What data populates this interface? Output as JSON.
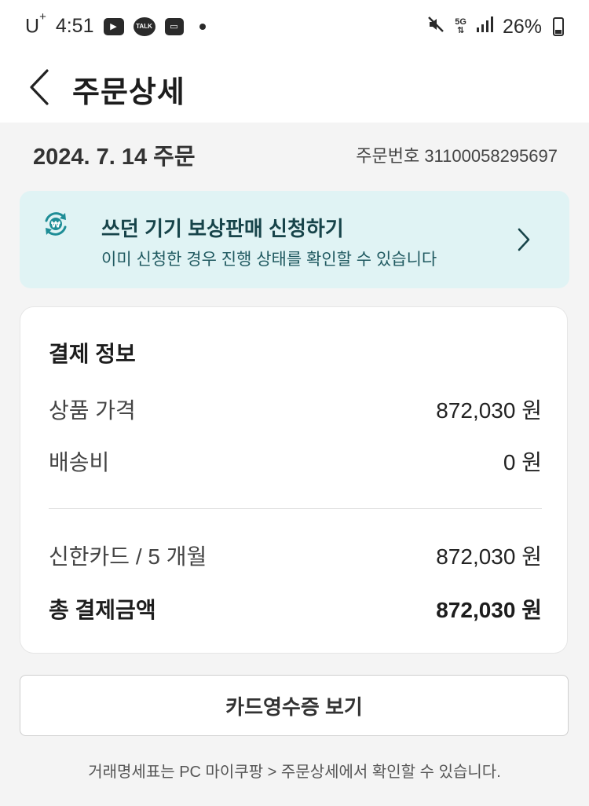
{
  "status_bar": {
    "carrier": "U",
    "carrier_sup": "+",
    "time": "4:51",
    "network": "5G",
    "battery": "26%"
  },
  "header": {
    "title": "주문상세"
  },
  "order": {
    "date_label": "2024. 7. 14 주문",
    "number_label": "주문번호 31100058295697"
  },
  "tradein": {
    "title": "쓰던 기기 보상판매 신청하기",
    "subtitle": "이미 신청한 경우 진행 상태를 확인할 수 있습니다",
    "accent": "#1e8d96"
  },
  "payment": {
    "title": "결제 정보",
    "rows": [
      {
        "label": "상품 가격",
        "value": "872,030 원"
      },
      {
        "label": "배송비",
        "value": "0 원"
      },
      {
        "label": "신한카드 / 5 개월",
        "value": "872,030 원"
      }
    ],
    "total": {
      "label": "총 결제금액",
      "value": "872,030 원"
    }
  },
  "receipt_button": "카드영수증 보기",
  "footer_note": "거래명세표는 PC 마이쿠팡 > 주문상세에서 확인할 수 있습니다."
}
